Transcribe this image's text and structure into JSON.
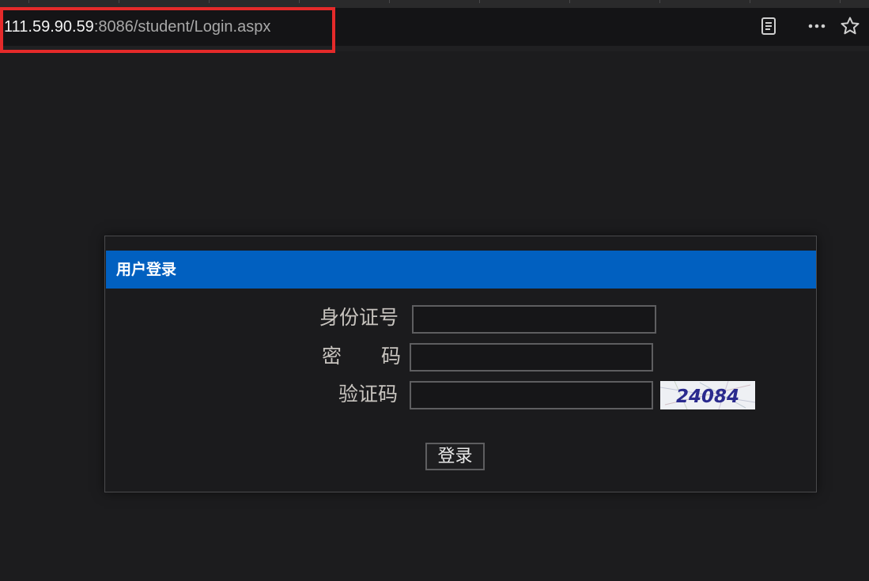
{
  "browser": {
    "url_host": "111.59.90.59",
    "url_rest": ":8086/student/Login.aspx",
    "icons": [
      "reader-view-icon",
      "more-icon",
      "favorite-star-icon"
    ],
    "highlight_color": "#e52a2a"
  },
  "login": {
    "title": "用户登录",
    "header_color": "#0160c0",
    "id_label": "身份证号",
    "id_value": "",
    "password_label": "密　　码",
    "password_value": "",
    "captcha_label": "验证码",
    "captcha_value": "",
    "captcha_code": "24084",
    "submit_label": "登录"
  }
}
